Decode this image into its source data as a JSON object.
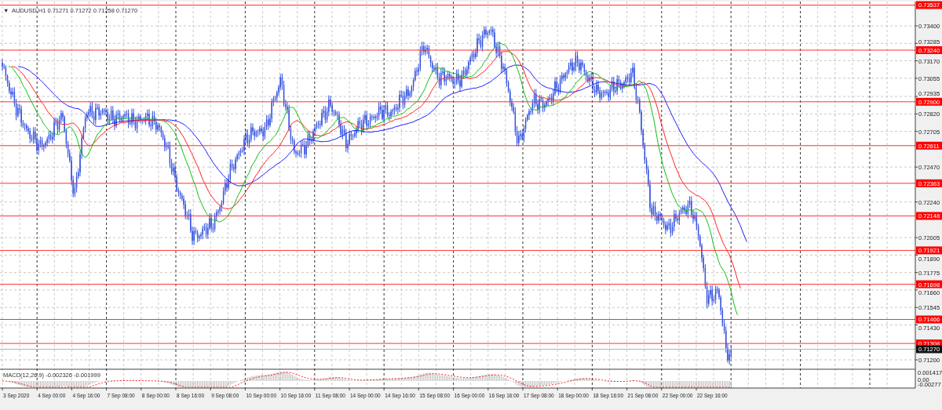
{
  "header": {
    "marker": "▼",
    "symbol": "AUDUSD,H1",
    "quotes": [
      "0.71271",
      "0.71272",
      "0.71258",
      "0.71270"
    ]
  },
  "price_axis": {
    "ticks": [
      "0.73400",
      "0.73285",
      "0.73170",
      "0.73055",
      "0.72935",
      "0.72820",
      "0.72705",
      "0.72470",
      "0.72240",
      "0.72005",
      "0.71890",
      "0.71775",
      "0.71660",
      "0.71545",
      "0.71430",
      "0.71200"
    ]
  },
  "levels": [
    {
      "price": "0.73537",
      "kind": "level"
    },
    {
      "price": "0.73240",
      "kind": "level"
    },
    {
      "price": "0.72900",
      "kind": "level"
    },
    {
      "price": "0.72611",
      "kind": "level"
    },
    {
      "price": "0.72363",
      "kind": "level"
    },
    {
      "price": "0.72148",
      "kind": "level"
    },
    {
      "price": "0.71921",
      "kind": "level"
    },
    {
      "price": "0.71698",
      "kind": "level"
    },
    {
      "price": "0.71466",
      "kind": "level"
    },
    {
      "price": "0.71308",
      "kind": "level"
    },
    {
      "price": "0.71270",
      "kind": "current"
    }
  ],
  "macd_pane": {
    "title": "MACD(12,26,9) -0.002326 -0.001999",
    "ticks": [
      "0.001417",
      "0.00",
      "-0.00277"
    ]
  },
  "time_axis": {
    "labels": [
      "3 Sep 2020",
      "4 Sep 00:00",
      "4 Sep 16:00",
      "7 Sep 08:00",
      "8 Sep 00:00",
      "8 Sep 16:00",
      "9 Sep 08:00",
      "10 Sep 00:00",
      "10 Sep 16:00",
      "11 Sep 08:00",
      "14 Sep 00:00",
      "14 Sep 16:00",
      "15 Sep 08:00",
      "16 Sep 00:00",
      "16 Sep 16:00",
      "17 Sep 08:00",
      "18 Sep 00:00",
      "18 Sep 16:00",
      "21 Sep 08:00",
      "22 Sep 00:00",
      "22 Sep 16:00"
    ]
  }
}
